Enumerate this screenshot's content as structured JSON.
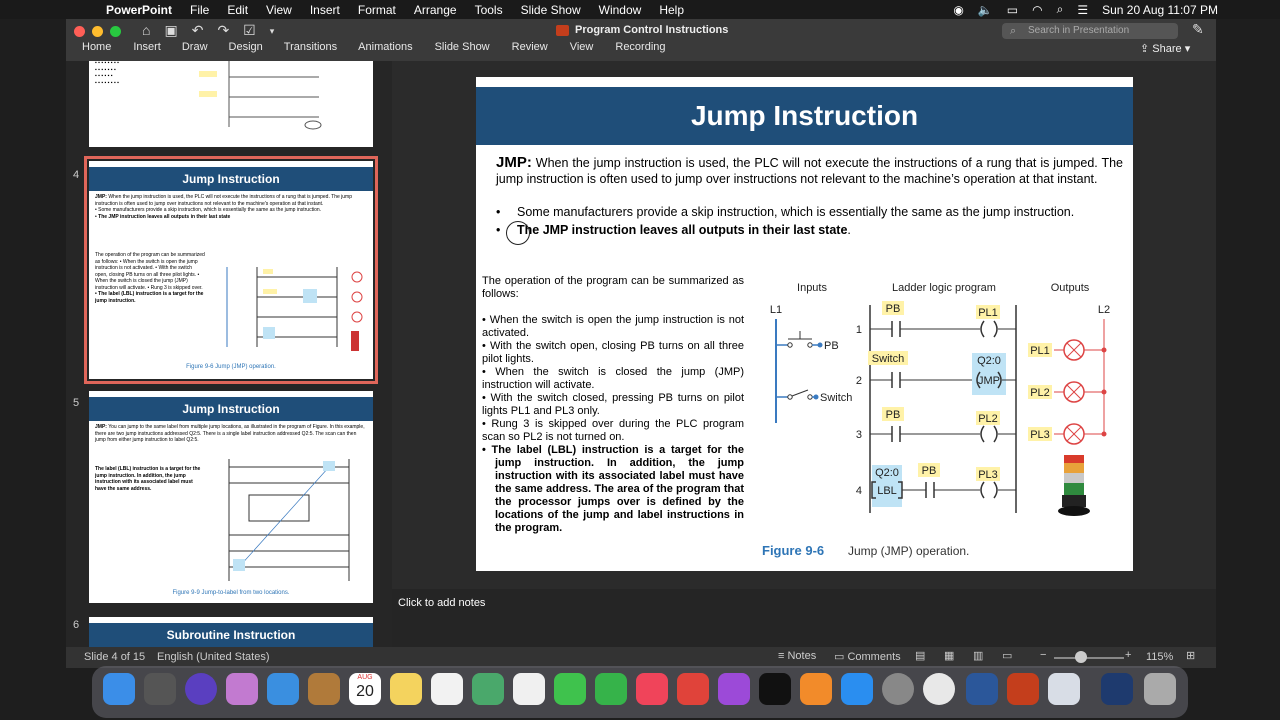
{
  "menubar": {
    "app": "PowerPoint",
    "items": [
      "File",
      "Edit",
      "View",
      "Insert",
      "Format",
      "Arrange",
      "Tools",
      "Slide Show",
      "Window",
      "Help"
    ],
    "datetime": "Sun 20 Aug  11:07 PM"
  },
  "window": {
    "title": "Program Control Instructions",
    "search_placeholder": "Search in Presentation",
    "share": "Share"
  },
  "ribbon": {
    "tabs": [
      "Home",
      "Insert",
      "Draw",
      "Design",
      "Transitions",
      "Animations",
      "Slide Show",
      "Review",
      "View",
      "Recording"
    ]
  },
  "thumbnails": [
    {
      "number": "4",
      "title": "Jump Instruction",
      "caption": "Figure 9-6  Jump (JMP) operation."
    },
    {
      "number": "5",
      "title": "Jump Instruction",
      "caption": "Figure 9-9  Jump-to-label from two locations."
    },
    {
      "number": "6",
      "title": "Subroutine Instruction"
    }
  ],
  "slide": {
    "title": "Jump Instruction",
    "jmp_label": "JMP:",
    "jmp_text": " When the jump instruction is used, the PLC will not execute the instructions of a rung that is jumped. The jump instruction is often used to jump over instructions not relevant to the machine’s operation at that instant.",
    "bullet1": "Some manufacturers provide a skip instruction, which is essentially the same as the jump instruction.",
    "bullet2": "The JMP instruction leaves all outputs in their last state",
    "bullet2_end": ".",
    "summary_intro": "The operation of the program can be summarized as follows:",
    "summary_items": [
      "• When the switch is open the jump instruction is not activated.",
      "• With the switch open, closing PB turns on all three pilot lights.",
      "• When the switch is closed the jump (JMP) instruction will activate.",
      "• With the switch closed, pressing PB turns on pilot lights PL1 and PL3 only.",
      "• Rung 3 is skipped over during the PLC program scan so PL2 is not turned on."
    ],
    "summary_bold": "• The label (LBL) instruction is a target for the jump instruction. In addition, the jump instruction with its associated label must have the same address. The area of the program that the processor jumps over is defined by the locations of the jump and label instructions in the program.",
    "figure": {
      "headers": {
        "inputs": "Inputs",
        "ladder": "Ladder logic program",
        "outputs": "Outputs"
      },
      "l1": "L1",
      "l2": "L2",
      "rungs": [
        "1",
        "2",
        "3",
        "4"
      ],
      "pb": "PB",
      "switch": "Switch",
      "q20": "Q2:0",
      "jmp": "JMP",
      "lbl": "LBL",
      "pl1": "PL1",
      "pl2": "PL2",
      "pl3": "PL3",
      "caption_num": "Figure 9-6",
      "caption_text": "Jump (JMP) operation."
    }
  },
  "notes_placeholder": "Click to add notes",
  "status": {
    "slide": "Slide 4 of 15",
    "language": "English (United States)",
    "notes": "Notes",
    "comments": "Comments",
    "zoom": "115%"
  },
  "dock": {
    "calendar_month": "AUG",
    "calendar_day": "20"
  },
  "colors": {
    "title_bar": "#1f4e79",
    "highlight": "#fff2a8",
    "caption_blue": "#2e75b6",
    "ppt_red": "#c43e1c"
  }
}
